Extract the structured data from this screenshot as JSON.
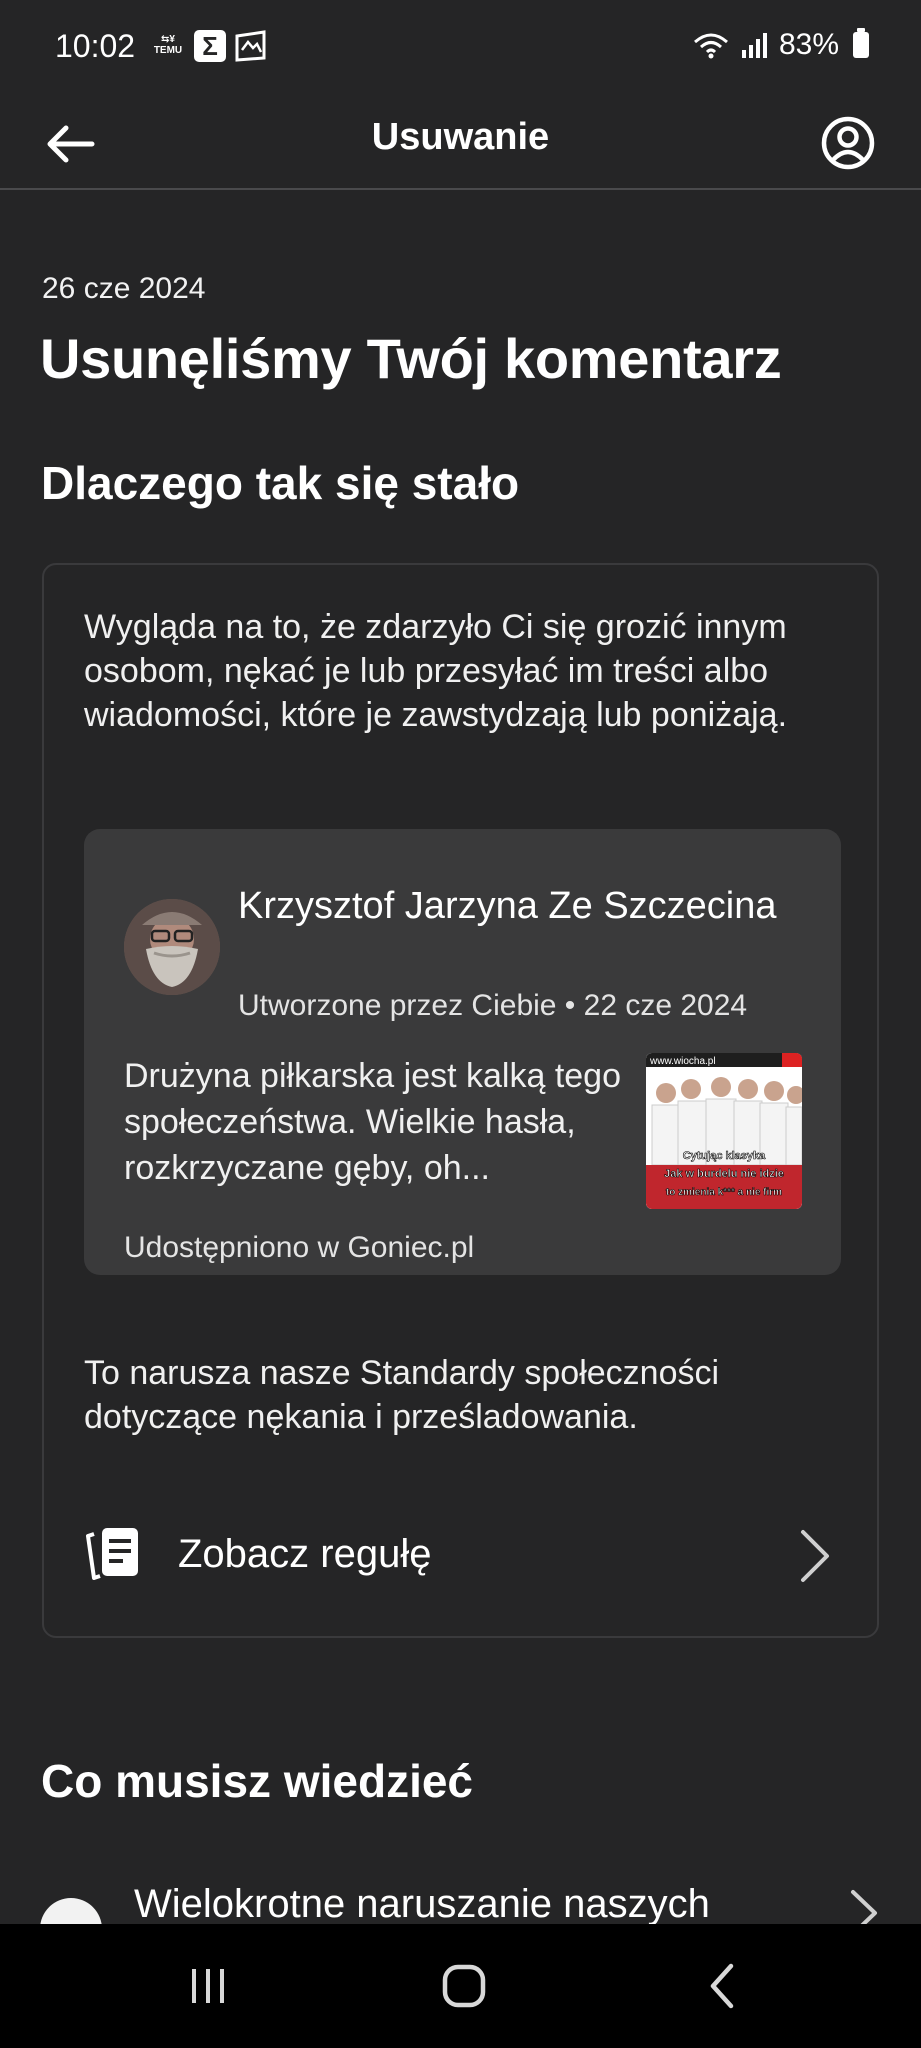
{
  "status_bar": {
    "time": "10:02",
    "temu_label": "TEMU",
    "temu_prefix": "⇆¥",
    "sigma_icon": "Σ",
    "battery": "83%"
  },
  "app_bar": {
    "title": "Usuwanie",
    "back_icon": "arrow-left-icon",
    "profile_icon": "account-circle-icon"
  },
  "main": {
    "date": "26 cze 2024",
    "headline": "Usunęliśmy Twój komentarz",
    "why_title": "Dlaczego tak się stało",
    "explanation": "Wygląda na to, że zdarzyło Ci się grozić innym osobom, nękać je lub przesyłać im treści albo wiadomości, które je zawstydzają lub poniżają.",
    "post": {
      "author": "Krzysztof Jarzyna Ze Szczecina",
      "meta": "Utworzone przez Ciebie • 22 cze 2024",
      "body": "Drużyna piłkarska jest kalką tego społeczeństwa. Wielkie hasła, rozkrzyczane gęby, oh...",
      "shared": "Udostępniono w Goniec.pl",
      "thumb_caption_1": "Cytując klasyka",
      "thumb_caption_2": "Jak w burdelu nie idzie",
      "thumb_caption_3": "to zmienia k*** a nie firm",
      "thumb_watermark": "www.wiocha.pl"
    },
    "violation_text": "To narusza nasze Standardy społeczności dotyczące nękania i prześladowania.",
    "rule_label": "Zobacz regułę",
    "know_title": "Co musisz wiedzieć",
    "repeat_violation_label": "Wielokrotne naruszanie naszych"
  },
  "colors": {
    "background": "#252526",
    "post_box": "#3a3a3b",
    "card_border": "#3a3a3c",
    "nav_bar": "#000000"
  }
}
